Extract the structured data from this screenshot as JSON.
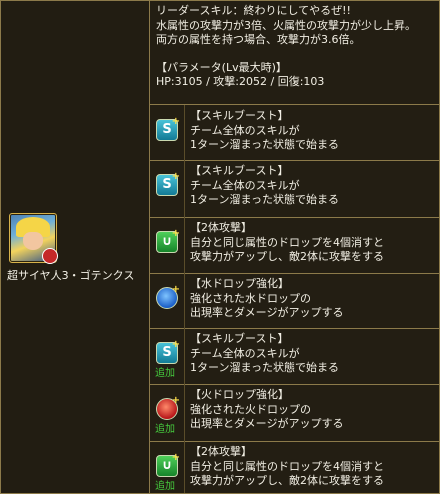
{
  "monster": {
    "name": "超サイヤ人3・ゴテンクス"
  },
  "leader_skill": {
    "lines": [
      "リーダースキル：終わりにしてやるぜ!!",
      "水属性の攻撃力が3倍、火属性の攻撃力が少し上昇。",
      "両方の属性を持つ場合、攻撃力が3.6倍。"
    ],
    "param_label": "【パラメータ(Lv最大時)】",
    "stats": "HP:3105 / 攻撃:2052 / 回復:103"
  },
  "awakenings": [
    {
      "icon": "skill-boost-icon",
      "type": "skill",
      "added": false,
      "title": "【スキルブースト】",
      "line1": "チーム全体のスキルが",
      "line2": "1ターン溜まった状態で始まる"
    },
    {
      "icon": "skill-boost-icon",
      "type": "skill",
      "added": false,
      "title": "【スキルブースト】",
      "line1": "チーム全体のスキルが",
      "line2": "1ターン溜まった状態で始まる"
    },
    {
      "icon": "two-pronged-attack-icon",
      "type": "two",
      "added": false,
      "title": "【2体攻撃】",
      "line1": "自分と同じ属性のドロップを4個消すと",
      "line2": "攻撃力がアップし、敵2体に攻撃をする"
    },
    {
      "icon": "water-drop-enhance-icon",
      "type": "water",
      "added": false,
      "title": "【水ドロップ強化】",
      "line1": "強化された水ドロップの",
      "line2": "出現率とダメージがアップする"
    },
    {
      "icon": "skill-boost-icon",
      "type": "skill",
      "added": true,
      "title": "【スキルブースト】",
      "line1": "チーム全体のスキルが",
      "line2": "1ターン溜まった状態で始まる"
    },
    {
      "icon": "fire-drop-enhance-icon",
      "type": "fire",
      "added": true,
      "title": "【火ドロップ強化】",
      "line1": "強化された火ドロップの",
      "line2": "出現率とダメージがアップする"
    },
    {
      "icon": "two-pronged-attack-icon",
      "type": "two",
      "added": true,
      "title": "【2体攻撃】",
      "line1": "自分と同じ属性のドロップを4個消すと",
      "line2": "攻撃力がアップし、敵2体に攻撃をする"
    }
  ],
  "added_label": "追加",
  "colors": {
    "background": "#231e13",
    "border": "#8c7a4a",
    "added_text": "#45c93d"
  }
}
